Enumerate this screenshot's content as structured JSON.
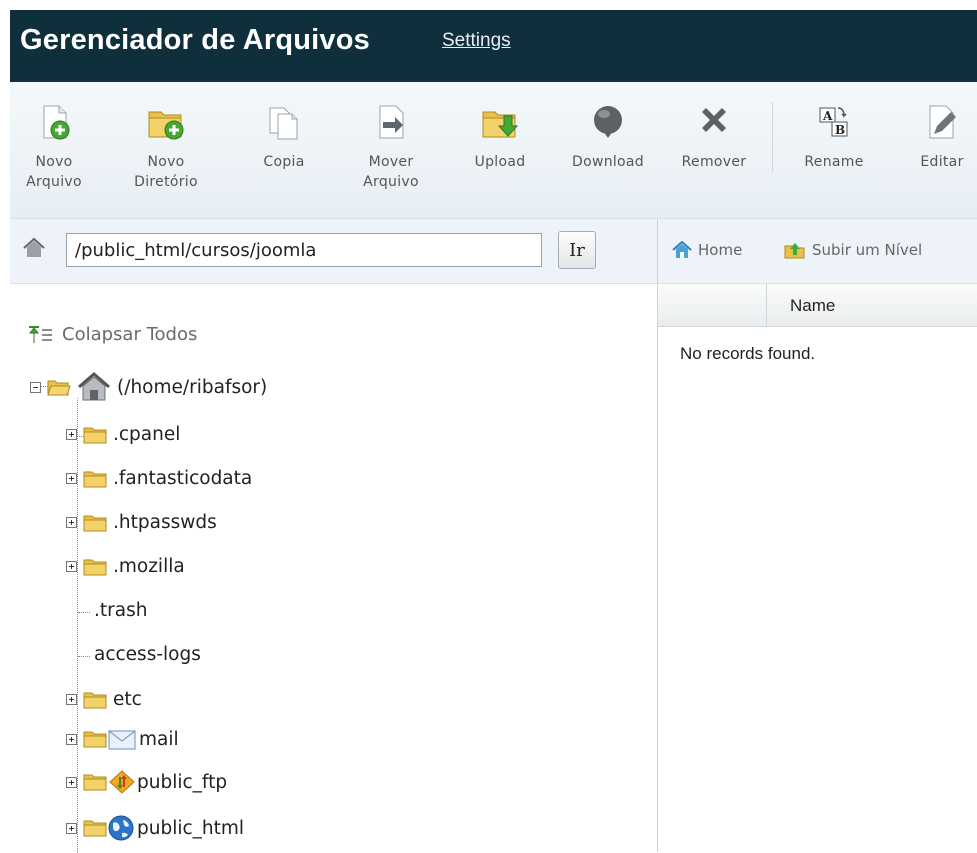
{
  "header": {
    "title": "Gerenciador de Arquivos",
    "settings_label": "Settings"
  },
  "toolbar": {
    "buttons": [
      {
        "id": "new-file",
        "label": "Novo Arquivo",
        "icon": "new-file-icon"
      },
      {
        "id": "new-folder",
        "label": "Novo Diretório",
        "icon": "new-folder-icon"
      },
      {
        "id": "copy",
        "label": "Copia",
        "icon": "copy-icon"
      },
      {
        "id": "move",
        "label": "Mover Arquivo",
        "icon": "move-icon"
      },
      {
        "id": "upload",
        "label": "Upload",
        "icon": "upload-icon"
      },
      {
        "id": "download",
        "label": "Download",
        "icon": "download-icon"
      },
      {
        "id": "remove",
        "label": "Remover",
        "icon": "delete-icon"
      },
      {
        "id": "rename",
        "label": "Rename",
        "icon": "rename-icon"
      },
      {
        "id": "edit",
        "label": "Editar",
        "icon": "edit-icon"
      }
    ]
  },
  "pathbar": {
    "path_value": "/public_html/cursos/joomla",
    "go_label": "Ir"
  },
  "nav": {
    "home_label": "Home",
    "up_label": "Subir um Nível"
  },
  "tree": {
    "collapse_label": "Colapsar Todos",
    "root_label": "(/home/ribafsor)",
    "items": [
      {
        "label": ".cpanel",
        "type": "folder"
      },
      {
        "label": ".fantasticodata",
        "type": "folder"
      },
      {
        "label": ".htpasswds",
        "type": "folder"
      },
      {
        "label": ".mozilla",
        "type": "folder"
      },
      {
        "label": ".trash",
        "type": "leaf"
      },
      {
        "label": "access-logs",
        "type": "leaf"
      },
      {
        "label": "etc",
        "type": "folder"
      },
      {
        "label": "mail",
        "type": "folder",
        "badge": "mail-icon"
      },
      {
        "label": "public_ftp",
        "type": "folder",
        "badge": "ftp-icon"
      },
      {
        "label": "public_html",
        "type": "folder",
        "badge": "globe-icon"
      }
    ]
  },
  "grid": {
    "column_name": "Name",
    "empty_message": "No records found."
  },
  "colors": {
    "header_bg": "#0f2f3c",
    "toolbar_bg": "#e7eef3",
    "folder": "#e8c24a"
  }
}
